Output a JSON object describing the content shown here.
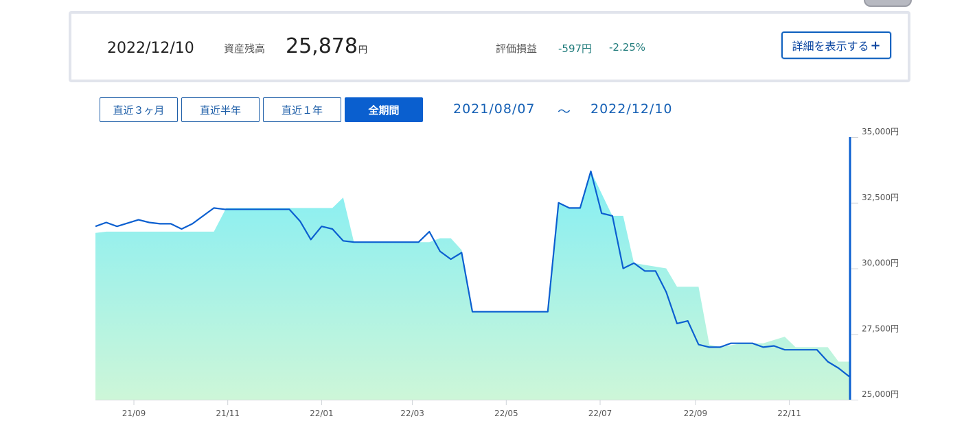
{
  "summary": {
    "date": "2022/12/10",
    "balance_label": "資産残高",
    "balance_value": "25,878",
    "yen": "円",
    "pl_label": "評価損益",
    "pl_value": "-597円",
    "pl_percent": "-2.25%",
    "detail_button": "詳細を表示する",
    "detail_icon": "plus-icon"
  },
  "period_buttons": [
    {
      "label": "直近３ヶ月",
      "active": false
    },
    {
      "label": "直近半年",
      "active": false
    },
    {
      "label": "直近１年",
      "active": false
    },
    {
      "label": "全期間",
      "active": true
    }
  ],
  "range": {
    "from": "2021/08/07",
    "sep": "～",
    "to": "2022/12/10"
  },
  "colors": {
    "accent": "#0a5fcf",
    "line": "#0b5fd0",
    "pl_text": "#217c7c",
    "area_top": "#84eef4",
    "area_bottom": "#cdf6d8"
  },
  "chart_data": {
    "type": "area",
    "title": "",
    "xlabel": "",
    "ylabel": "",
    "ylim": [
      25000,
      35000
    ],
    "x_range": [
      "2021-08-07",
      "2022-12-10"
    ],
    "yticks": [
      {
        "value": 25000,
        "label": "25,000円"
      },
      {
        "value": 27500,
        "label": "27,500円"
      },
      {
        "value": 30000,
        "label": "30,000円"
      },
      {
        "value": 32500,
        "label": "32,500円"
      },
      {
        "value": 35000,
        "label": "35,000円"
      }
    ],
    "xticks": [
      {
        "date": "2021-09-01",
        "label": "21/09"
      },
      {
        "date": "2021-11-01",
        "label": "21/11"
      },
      {
        "date": "2022-01-01",
        "label": "22/01"
      },
      {
        "date": "2022-03-01",
        "label": "22/03"
      },
      {
        "date": "2022-05-01",
        "label": "22/05"
      },
      {
        "date": "2022-07-01",
        "label": "22/07"
      },
      {
        "date": "2022-09-01",
        "label": "22/09"
      },
      {
        "date": "2022-11-01",
        "label": "22/11"
      }
    ],
    "series": [
      {
        "kind": "area",
        "points": [
          [
            "2021-08-07",
            31350
          ],
          [
            "2021-08-14",
            31400
          ],
          [
            "2021-10-23",
            31400
          ],
          [
            "2021-10-31",
            32300
          ],
          [
            "2021-12-25",
            32300
          ],
          [
            "2022-01-08",
            32300
          ],
          [
            "2022-01-15",
            32700
          ],
          [
            "2022-01-22",
            31000
          ],
          [
            "2022-03-12",
            31000
          ],
          [
            "2022-03-19",
            31150
          ],
          [
            "2022-03-26",
            31150
          ],
          [
            "2022-04-02",
            30700
          ],
          [
            "2022-04-09",
            28350
          ],
          [
            "2022-05-28",
            28350
          ],
          [
            "2022-06-04",
            32500
          ],
          [
            "2022-06-11",
            32300
          ],
          [
            "2022-06-18",
            32300
          ],
          [
            "2022-06-25",
            33700
          ],
          [
            "2022-07-09",
            32000
          ],
          [
            "2022-07-16",
            32000
          ],
          [
            "2022-07-23",
            30200
          ],
          [
            "2022-08-13",
            30000
          ],
          [
            "2022-08-20",
            29300
          ],
          [
            "2022-08-27",
            29300
          ],
          [
            "2022-09-03",
            29300
          ],
          [
            "2022-09-10",
            27100
          ],
          [
            "2022-09-17",
            27000
          ],
          [
            "2022-10-01",
            27150
          ],
          [
            "2022-10-15",
            27150
          ],
          [
            "2022-10-29",
            27400
          ],
          [
            "2022-11-05",
            27000
          ],
          [
            "2022-11-26",
            27000
          ],
          [
            "2022-12-03",
            26450
          ],
          [
            "2022-12-10",
            26450
          ]
        ]
      },
      {
        "kind": "line",
        "points": [
          [
            "2021-08-07",
            31600
          ],
          [
            "2021-08-14",
            31750
          ],
          [
            "2021-08-21",
            31600
          ],
          [
            "2021-09-04",
            31850
          ],
          [
            "2021-09-11",
            31750
          ],
          [
            "2021-09-18",
            31700
          ],
          [
            "2021-09-25",
            31700
          ],
          [
            "2021-10-02",
            31500
          ],
          [
            "2021-10-09",
            31700
          ],
          [
            "2021-10-23",
            32300
          ],
          [
            "2021-10-30",
            32250
          ],
          [
            "2021-12-11",
            32250
          ],
          [
            "2021-12-18",
            31800
          ],
          [
            "2021-12-25",
            31100
          ],
          [
            "2022-01-01",
            31600
          ],
          [
            "2022-01-08",
            31500
          ],
          [
            "2022-01-15",
            31050
          ],
          [
            "2022-01-22",
            31000
          ],
          [
            "2022-03-05",
            31000
          ],
          [
            "2022-03-12",
            31400
          ],
          [
            "2022-03-19",
            30650
          ],
          [
            "2022-03-26",
            30350
          ],
          [
            "2022-04-02",
            30600
          ],
          [
            "2022-04-09",
            28350
          ],
          [
            "2022-05-28",
            28350
          ],
          [
            "2022-06-04",
            32500
          ],
          [
            "2022-06-11",
            32300
          ],
          [
            "2022-06-18",
            32300
          ],
          [
            "2022-06-25",
            33700
          ],
          [
            "2022-07-02",
            32100
          ],
          [
            "2022-07-09",
            32000
          ],
          [
            "2022-07-16",
            30000
          ],
          [
            "2022-07-23",
            30200
          ],
          [
            "2022-07-30",
            29900
          ],
          [
            "2022-08-06",
            29900
          ],
          [
            "2022-08-13",
            29100
          ],
          [
            "2022-08-20",
            27900
          ],
          [
            "2022-08-27",
            28000
          ],
          [
            "2022-09-03",
            27100
          ],
          [
            "2022-09-10",
            27000
          ],
          [
            "2022-09-17",
            27000
          ],
          [
            "2022-09-24",
            27150
          ],
          [
            "2022-10-08",
            27150
          ],
          [
            "2022-10-15",
            27000
          ],
          [
            "2022-10-22",
            27050
          ],
          [
            "2022-10-29",
            26900
          ],
          [
            "2022-11-19",
            26900
          ],
          [
            "2022-11-26",
            26450
          ],
          [
            "2022-12-03",
            26200
          ],
          [
            "2022-12-10",
            25878
          ]
        ]
      }
    ]
  }
}
